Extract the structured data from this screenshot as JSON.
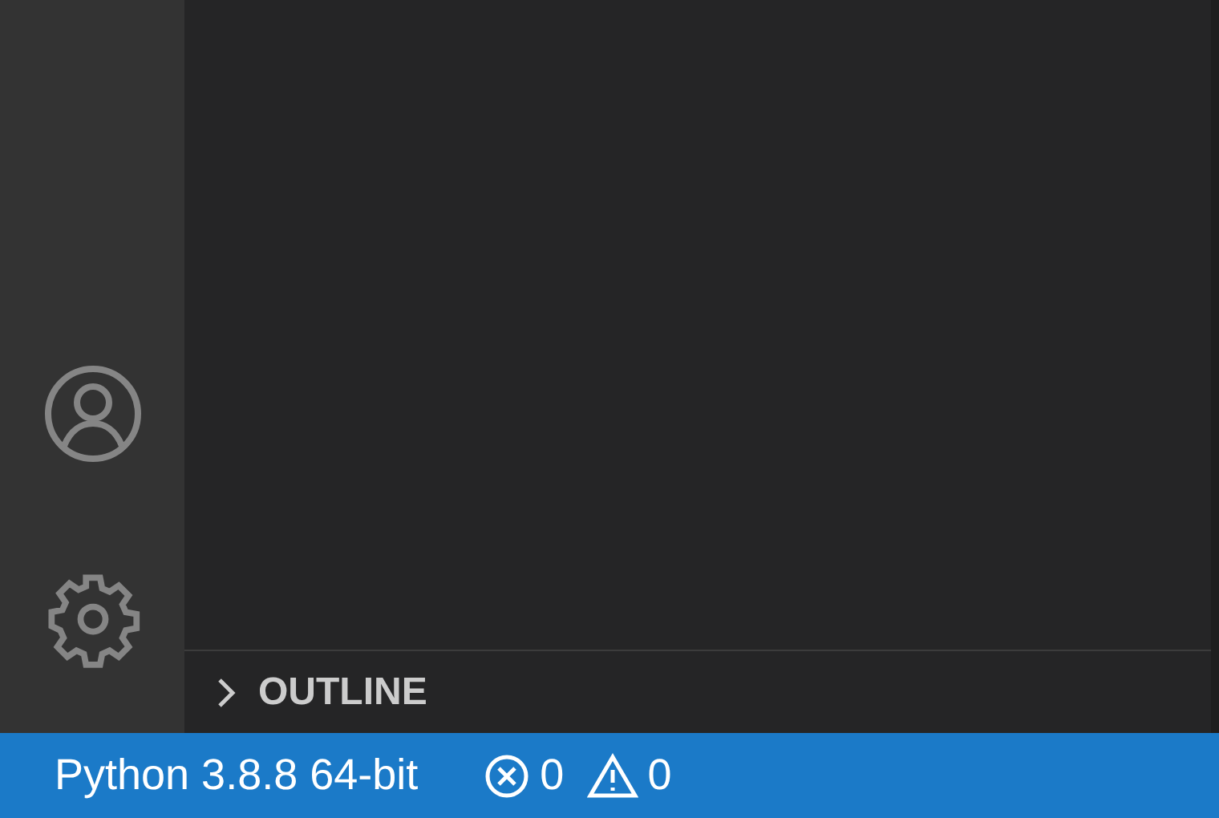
{
  "sidebar": {
    "sections": [
      {
        "title": "OUTLINE",
        "expanded": false
      }
    ]
  },
  "status_bar": {
    "interpreter": "Python 3.8.8 64-bit",
    "errors": "0",
    "warnings": "0"
  }
}
